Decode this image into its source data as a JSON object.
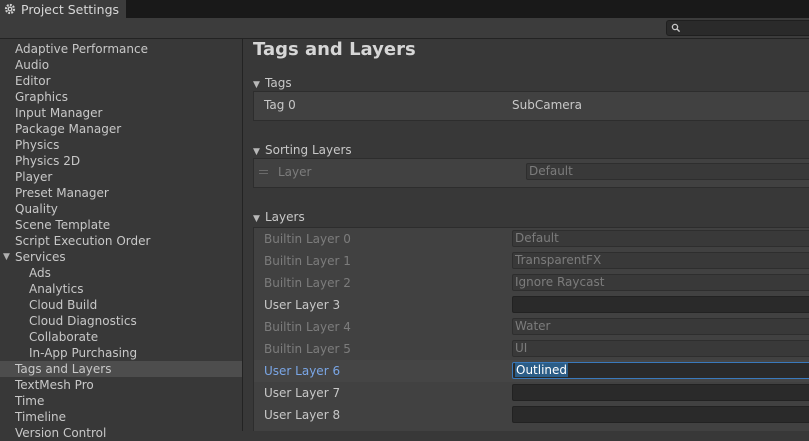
{
  "window": {
    "tab_title": "Project Settings"
  },
  "search": {
    "placeholder": ""
  },
  "sidebar": {
    "items": [
      {
        "label": "Adaptive Performance"
      },
      {
        "label": "Audio"
      },
      {
        "label": "Editor"
      },
      {
        "label": "Graphics"
      },
      {
        "label": "Input Manager"
      },
      {
        "label": "Package Manager"
      },
      {
        "label": "Physics"
      },
      {
        "label": "Physics 2D"
      },
      {
        "label": "Player"
      },
      {
        "label": "Preset Manager"
      },
      {
        "label": "Quality"
      },
      {
        "label": "Scene Template"
      },
      {
        "label": "Script Execution Order"
      },
      {
        "label": "Services"
      },
      {
        "label": "Ads"
      },
      {
        "label": "Analytics"
      },
      {
        "label": "Cloud Build"
      },
      {
        "label": "Cloud Diagnostics"
      },
      {
        "label": "Collaborate"
      },
      {
        "label": "In-App Purchasing"
      },
      {
        "label": "Tags and Layers"
      },
      {
        "label": "TextMesh Pro"
      },
      {
        "label": "Time"
      },
      {
        "label": "Timeline"
      },
      {
        "label": "Version Control"
      }
    ],
    "selected": "Tags and Layers"
  },
  "main": {
    "title": "Tags and Layers",
    "tags": {
      "header": "Tags",
      "rows": [
        {
          "label": "Tag 0",
          "value": "SubCamera"
        }
      ]
    },
    "sorting_layers": {
      "header": "Sorting Layers",
      "rows": [
        {
          "label": "Layer",
          "value": "Default"
        }
      ]
    },
    "layers": {
      "header": "Layers",
      "rows": [
        {
          "label": "Builtin Layer 0",
          "value": "Default",
          "disabled": true
        },
        {
          "label": "Builtin Layer 1",
          "value": "TransparentFX",
          "disabled": true
        },
        {
          "label": "Builtin Layer 2",
          "value": "Ignore Raycast",
          "disabled": true
        },
        {
          "label": "User Layer 3",
          "value": "",
          "disabled": false
        },
        {
          "label": "Builtin Layer 4",
          "value": "Water",
          "disabled": true
        },
        {
          "label": "Builtin Layer 5",
          "value": "UI",
          "disabled": true
        },
        {
          "label": "User Layer 6",
          "value": "Outlined",
          "disabled": false,
          "active": true
        },
        {
          "label": "User Layer 7",
          "value": "",
          "disabled": false
        },
        {
          "label": "User Layer 8",
          "value": "",
          "disabled": false
        }
      ]
    }
  },
  "colors": {
    "selection_blue": "#2c5d87",
    "active_label": "#7aa6e6"
  }
}
